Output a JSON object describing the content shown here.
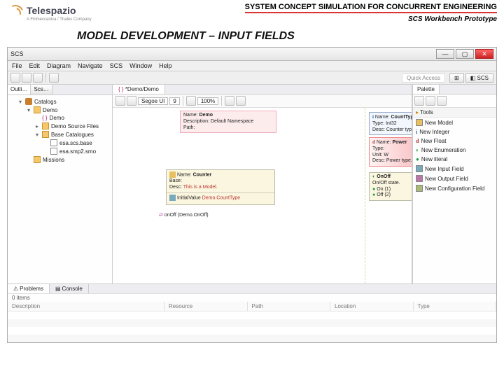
{
  "logo": {
    "brand": "Telespazio",
    "tagline": "A Finmeccanica / Thales Company"
  },
  "slide": {
    "system_title": "SYSTEM CONCEPT SIMULATION FOR CONCURRENT ENGINEERING",
    "sub_title": "SCS Workbench Prototype",
    "heading": "MODEL DEVELOPMENT – INPUT FIELDS"
  },
  "window": {
    "title": "SCS"
  },
  "menu": [
    "File",
    "Edit",
    "Diagram",
    "Navigate",
    "SCS",
    "Window",
    "Help"
  ],
  "quick_access": "Quick Access",
  "perspective": {
    "label": "SCS",
    "icon": "scs-icon"
  },
  "outline": {
    "tabs": [
      "Outli…",
      "Scs…"
    ],
    "root": "Catalogs",
    "items": [
      {
        "label": "Demo",
        "expanded": true,
        "children": [
          {
            "label": "Demo",
            "icon": "braces"
          },
          {
            "label": "Demo Source Files",
            "expandable": true
          },
          {
            "label": "Base Catalogues",
            "expanded": true,
            "children": [
              {
                "label": "esa.scs.base",
                "icon": "file"
              },
              {
                "label": "esa.smp2.smo",
                "icon": "file"
              }
            ]
          }
        ]
      },
      {
        "label": "Missions",
        "icon": "folder"
      }
    ]
  },
  "editor": {
    "tab": "*Demo/Demo",
    "font_selector": "Segoe UI",
    "size_selector": "9",
    "zoom": "100%",
    "name_node": {
      "name_label": "Name:",
      "name_value": "Demo",
      "desc_label": "Description:",
      "desc_value": "Default Namespace",
      "path_label": "Path:"
    },
    "counter_node": {
      "name_label": "Name:",
      "name_value": "Counter",
      "base_label": "Base:",
      "desc_label": "Desc:",
      "desc_value": "This is a Model.",
      "init_label": "InitialValue",
      "init_value": "Demo.CountType"
    },
    "count_type": {
      "name_label": "Name:",
      "name_value": "CountType",
      "type_label": "Type:",
      "type_value": "Int32",
      "desc_label": "Desc:",
      "desc_value": "Counter type."
    },
    "power": {
      "name_label": "Name:",
      "name_value": "Power",
      "type_label": "Type:",
      "unit_label": "Unit:",
      "unit_value": "W",
      "desc_label": "Desc:",
      "desc_value": "Power type."
    },
    "onoff": {
      "name_label": "OnOff",
      "sub_label": "On/Off state.",
      "on_label": "On (1)",
      "off_label": "Off (2)"
    },
    "port_label": "onOff (Demo.OnOff)"
  },
  "palette": {
    "tab": "Palette",
    "section": "Tools",
    "items": [
      "New Model",
      "New Integer",
      "New Float",
      "New Enumeration",
      "New literal",
      "New Input Field",
      "New Output Field",
      "New Configuration Field"
    ]
  },
  "problems": {
    "tabs": [
      "Problems",
      "Console"
    ],
    "count": "0 items",
    "columns": [
      "Description",
      "Resource",
      "Path",
      "Location",
      "Type"
    ]
  }
}
